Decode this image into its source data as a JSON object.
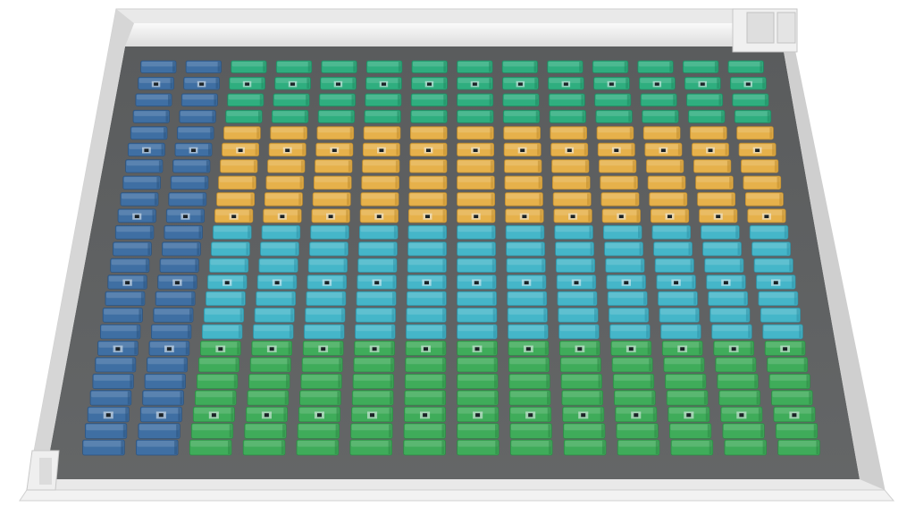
{
  "scene": {
    "type": "isometric-warehouse-floor-plan",
    "aisle_count": 14,
    "units_per_aisle": 24,
    "colors": {
      "wall_top": "#f4f4f4",
      "wall_inner": "#d9d9d9",
      "wall_shadow": "#bdbdbd",
      "floor": "#5d5f60",
      "floor_shade": "#4e5051",
      "label_mark": "#1b2226"
    },
    "zones": [
      {
        "name": "navy",
        "color": "#3f6fa3",
        "dark": "#2c5480"
      },
      {
        "name": "teal",
        "color": "#2fae7f",
        "dark": "#1f8a61"
      },
      {
        "name": "amber",
        "color": "#e6b14b",
        "dark": "#c08d2e"
      },
      {
        "name": "cyan",
        "color": "#45b6c9",
        "dark": "#2f92a5"
      },
      {
        "name": "green",
        "color": "#3fac5a",
        "dark": "#2e8a45"
      }
    ],
    "aisle_zone_pattern": {
      "left_blue_aisles": 2,
      "teal_rows": 4,
      "amber_rows": 6,
      "cyan_rows": 7,
      "green_rows": 7
    }
  }
}
